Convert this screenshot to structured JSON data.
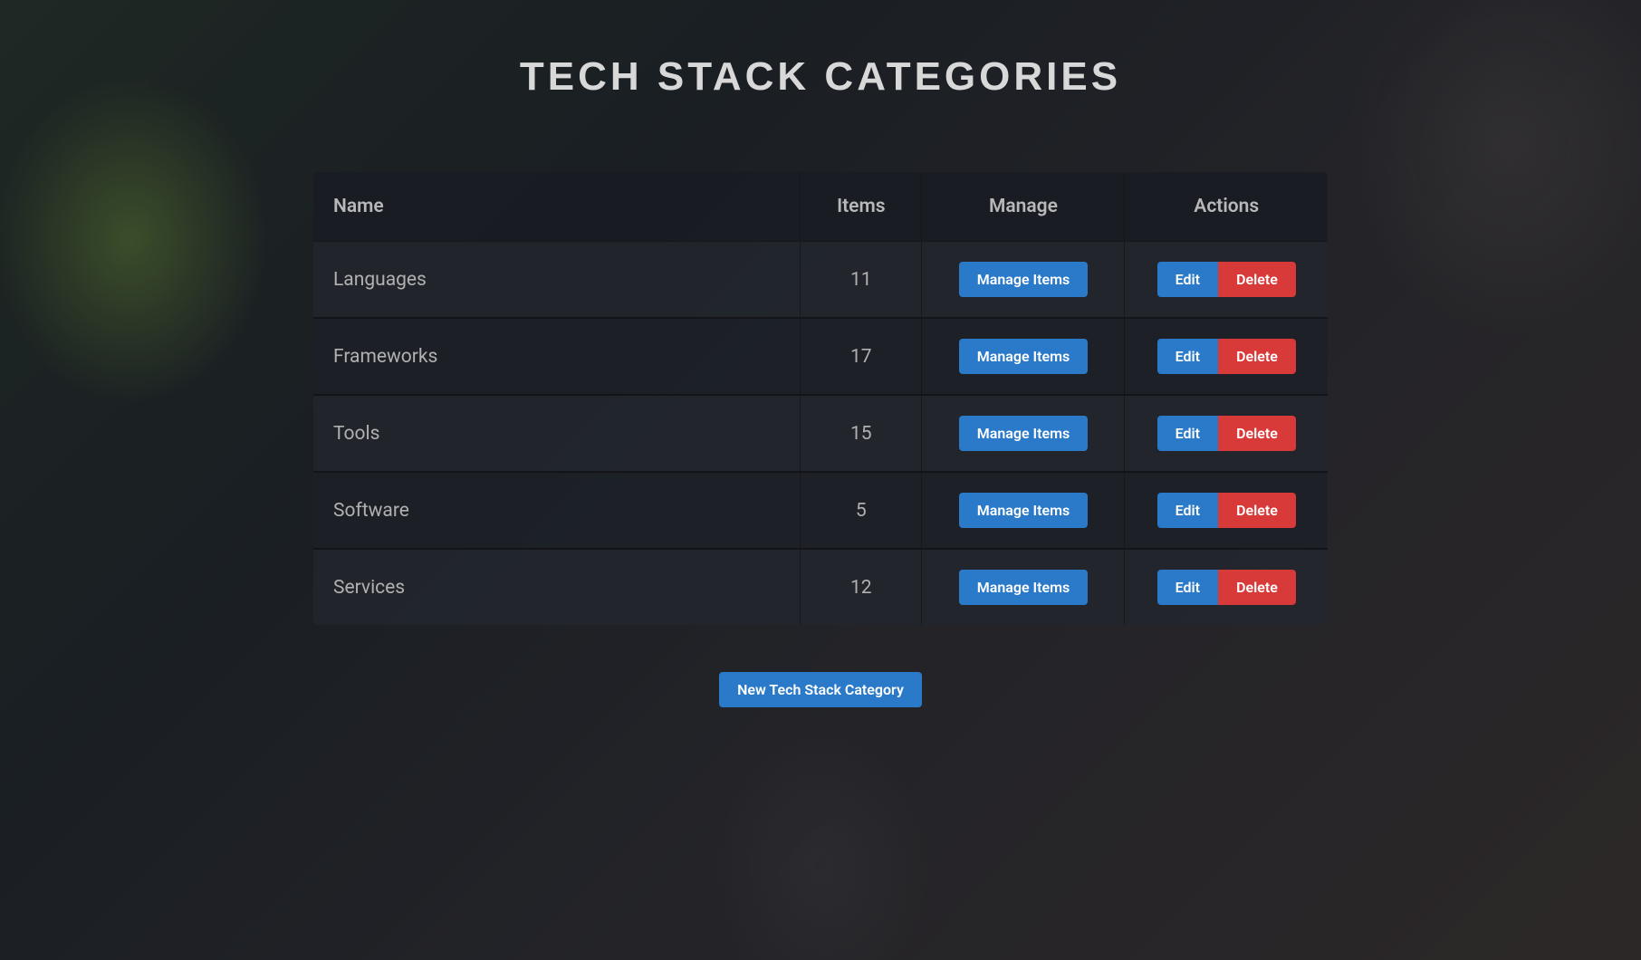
{
  "page_title": "TECH STACK CATEGORIES",
  "table": {
    "headers": {
      "name": "Name",
      "items": "Items",
      "manage": "Manage",
      "actions": "Actions"
    },
    "rows": [
      {
        "name": "Languages",
        "items": "11"
      },
      {
        "name": "Frameworks",
        "items": "17"
      },
      {
        "name": "Tools",
        "items": "15"
      },
      {
        "name": "Software",
        "items": "5"
      },
      {
        "name": "Services",
        "items": "12"
      }
    ]
  },
  "buttons": {
    "manage_items": "Manage Items",
    "edit": "Edit",
    "delete": "Delete",
    "new_category": "New Tech Stack Category"
  }
}
